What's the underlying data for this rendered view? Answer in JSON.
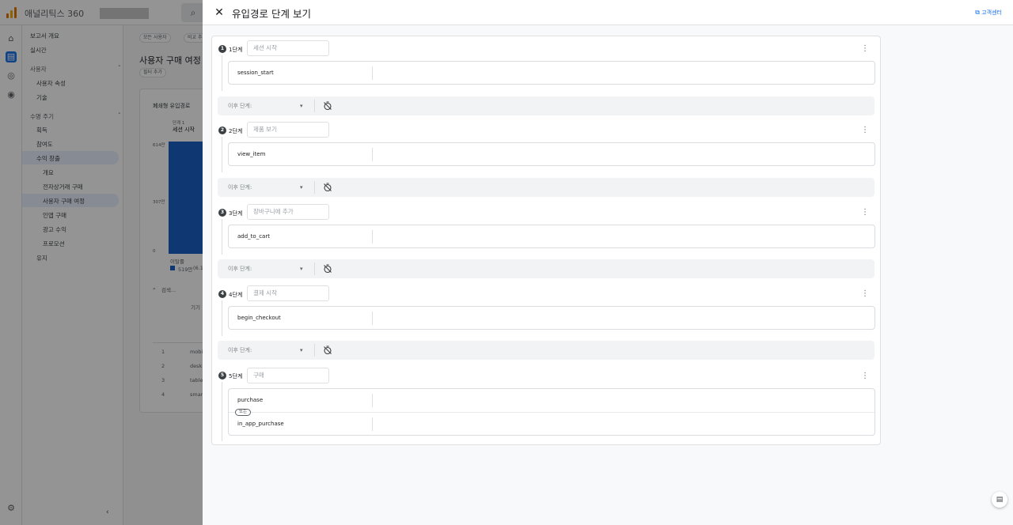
{
  "app": {
    "name": "애널리틱스 360",
    "search_icon": "search-icon"
  },
  "nav": {
    "items": [
      "보고서 개요",
      "실시간"
    ],
    "user_section": {
      "title": "사용자",
      "items": [
        "사용자 속성",
        "기술"
      ]
    },
    "lifecycle_section": {
      "title": "수명 주기",
      "items": [
        "획득",
        "참여도",
        "수익 창출"
      ]
    },
    "monetization_items": [
      "개요",
      "전자상거래 구매",
      "사용자 구매 여정",
      "인앱 구매",
      "광고 수익",
      "프로모션"
    ],
    "retention": "유지"
  },
  "main": {
    "segment_chip": "모든 사용자",
    "compare_chip": "비교 추",
    "page_title": "사용자 구매 여정",
    "filter_chip": "필터 추가",
    "card_title": "폐쇄형 유입경로",
    "step_label": "단계 1",
    "step_name": "세션 시작",
    "y_ticks": [
      "614만",
      "307만",
      "0"
    ],
    "dropoff_label": "이탈률",
    "legend_value": "519만",
    "legend_pct": "(6.1",
    "search_placeholder": "검색...",
    "col_header": "기기",
    "rows": [
      {
        "rank": "1",
        "name": "mobi"
      },
      {
        "rank": "2",
        "name": "desk"
      },
      {
        "rank": "3",
        "name": "table"
      },
      {
        "rank": "4",
        "name": "smar"
      }
    ]
  },
  "panel": {
    "title": "유입경로 단계 보기",
    "help_link": "고객센터",
    "gap_select": "이후 단계:",
    "steps": [
      {
        "num": "1",
        "label": "1단계",
        "name": "세션 시작",
        "events": [
          "session_start"
        ]
      },
      {
        "num": "2",
        "label": "2단계",
        "name": "제품 보기",
        "events": [
          "view_item"
        ]
      },
      {
        "num": "3",
        "label": "3단계",
        "name": "장바구니에 추가",
        "events": [
          "add_to_cart"
        ]
      },
      {
        "num": "4",
        "label": "4단계",
        "name": "결제 시작",
        "events": [
          "begin_checkout"
        ]
      },
      {
        "num": "5",
        "label": "5단계",
        "name": "구매",
        "events": [
          "purchase",
          "in_app_purchase"
        ],
        "or_badge": "또는"
      }
    ]
  },
  "colors": {
    "accent": "#1a73e8",
    "bar": "#1a5fc5",
    "overlay": "rgba(0,0,0,0.42)"
  }
}
